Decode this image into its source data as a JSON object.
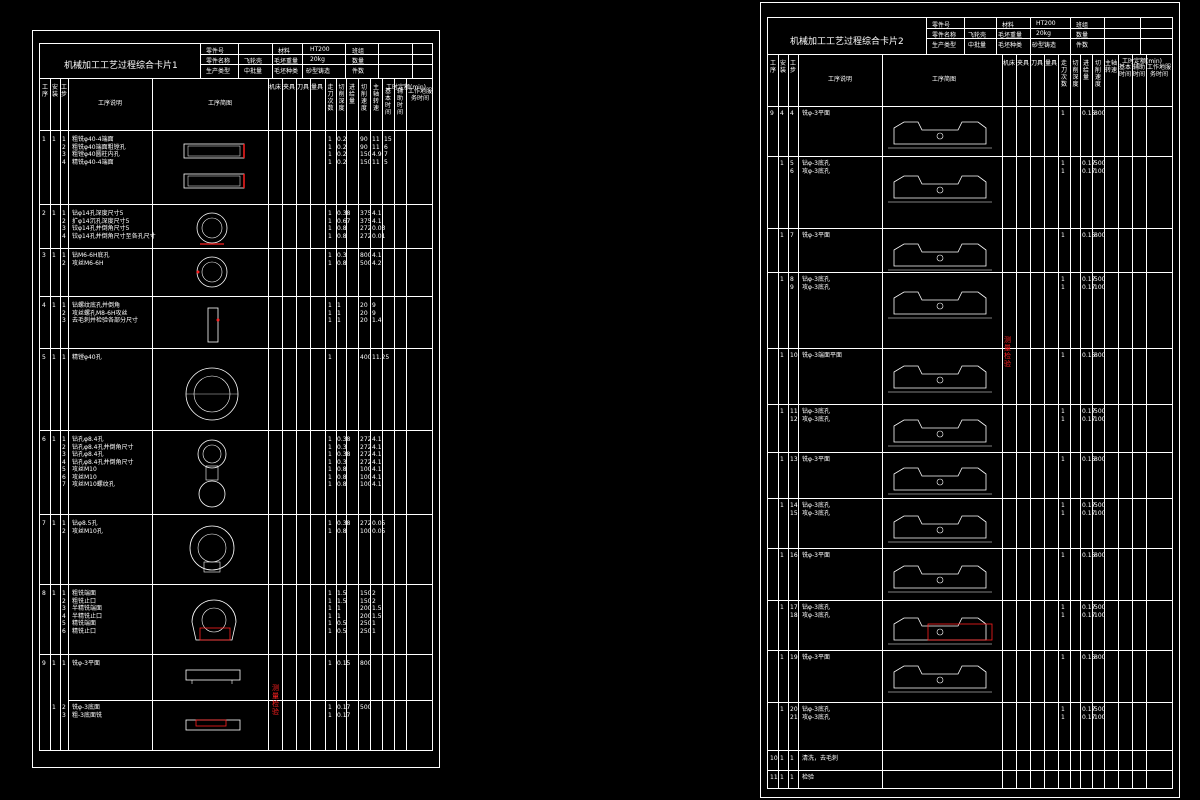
{
  "sheet1": {
    "title": "机械加工工艺过程综合卡片1",
    "header": {
      "label_a": "零件号",
      "label_b": "零件名称",
      "label_c": "生产类型",
      "val_b": "飞轮壳",
      "val_c": "中批量",
      "label_d": "材料",
      "label_e": "毛坯重量",
      "label_f": "毛坯种类",
      "val_d": "HT200",
      "val_e": "20kg",
      "val_f": "砂型铸造",
      "label_g": "班组",
      "label_h": "数量",
      "label_i": "件数",
      "time_label": "工时定额(min)"
    },
    "cols": [
      "工序",
      "安装",
      "工步",
      "工序说明",
      "工序简图",
      "机床",
      "夹具",
      "刀具",
      "量具",
      "走刀次数",
      "切削深度",
      "进给量",
      "切削速度",
      "主轴转速",
      "基本时间",
      "辅助时间",
      "工作地服务时间"
    ],
    "rows": [
      {
        "op": "1",
        "inst": "1",
        "steps": [
          "1",
          "2",
          "3",
          "4"
        ],
        "lines": [
          "粗铣φ40-4端面",
          "粗铣φ40端面粗镗孔",
          "粗镗φ40圆柱内孔",
          "精铣φ40-4端面"
        ],
        "nums": [
          "1",
          "1",
          "1",
          "1"
        ],
        "vals": [
          "0.2",
          "0.2",
          "0.2",
          "0.2"
        ],
        "speed": [
          "90",
          "90",
          "150",
          "150"
        ],
        "time": [
          "11",
          "11",
          "4.9",
          "11"
        ],
        "aux": [
          "15",
          "6",
          "7",
          "5"
        ]
      },
      {
        "op": "2",
        "inst": "1",
        "steps": [
          "1",
          "2",
          "3",
          "4"
        ],
        "lines": [
          "钻φ14孔深度尺寸5",
          "扩φ14沉孔深度尺寸5",
          "铰φ14孔并倒角尺寸5",
          "铰φ14孔并倒角尺寸至各孔尺寸"
        ],
        "nums": [
          "1",
          "1",
          "1",
          "1"
        ],
        "vals": [
          "0.38",
          "0.67",
          "0.8",
          "0.8"
        ],
        "speed": [
          "375",
          "375",
          "272",
          "272"
        ],
        "time": [
          "4.1",
          "4.1",
          "0.03",
          "0.01"
        ],
        "aux": []
      },
      {
        "op": "3",
        "inst": "1",
        "steps": [
          "1",
          "2"
        ],
        "lines": [
          "钻M6-6H底孔",
          "攻丝M6-6H"
        ],
        "nums": [
          "1",
          "1"
        ],
        "vals": [
          "0.3",
          "0.8"
        ],
        "speed": [
          "800",
          "500"
        ],
        "time": [
          "4.1",
          "4.2"
        ],
        "aux": []
      },
      {
        "op": "4",
        "inst": "1",
        "steps": [
          "1",
          "2",
          "3"
        ],
        "lines": [
          "钻螺纹底孔并倒角",
          "攻丝螺孔M8-6H攻丝",
          "去毛刺并检验各部分尺寸"
        ],
        "nums": [
          "1",
          "1",
          "1"
        ],
        "vals": [
          "1",
          "1",
          "1"
        ],
        "speed": [
          "20",
          "20",
          "20"
        ],
        "time": [
          "9",
          "9",
          "1.4"
        ],
        "aux": []
      },
      {
        "op": "5",
        "inst": "1",
        "steps": [
          "1"
        ],
        "lines": [
          "精镗φ40孔"
        ],
        "nums": [
          "1"
        ],
        "vals": [
          ""
        ],
        "speed": [
          "400"
        ],
        "time": [
          "11.25"
        ],
        "aux": []
      },
      {
        "op": "6",
        "inst": "1",
        "steps": [
          "1",
          "2",
          "3",
          "4",
          "5",
          "6",
          "7"
        ],
        "lines": [
          "钻孔φ8.4孔",
          "钻孔φ8.4孔并倒角尺寸",
          "钻孔φ8.4孔",
          "钻孔φ8.4孔并倒角尺寸",
          "攻丝M10",
          "攻丝M10",
          "攻丝M10螺纹孔"
        ],
        "nums": [
          "1",
          "1",
          "1",
          "1",
          "1",
          "1",
          "1"
        ],
        "vals": [
          "0.38",
          "0.3",
          "0.38",
          "0.3",
          "0.8",
          "0.8",
          "0.8"
        ],
        "speed": [
          "272",
          "272",
          "272",
          "272",
          "100",
          "100",
          "100"
        ],
        "time": [
          "4.1",
          "4.1",
          "4.1",
          "4.1",
          "4.1",
          "4.1",
          "4.1"
        ],
        "aux": []
      },
      {
        "op": "7",
        "inst": "1",
        "steps": [
          "1",
          "2"
        ],
        "lines": [
          "钻φ8.5孔",
          "攻丝M10孔"
        ],
        "nums": [
          "1",
          "1"
        ],
        "vals": [
          "0.38",
          "0.8"
        ],
        "speed": [
          "272",
          "100"
        ],
        "time": [
          "0.05",
          "0.05"
        ],
        "aux": []
      },
      {
        "op": "8",
        "inst": "1",
        "steps": [
          "1",
          "2",
          "3",
          "4",
          "5",
          "6"
        ],
        "lines": [
          "粗铣端面",
          "粗铣止口",
          "半精铣端面",
          "半精铣止口",
          "精铣端面",
          "精铣止口"
        ],
        "nums": [
          "1",
          "1",
          "1",
          "1",
          "1",
          "1"
        ],
        "vals": [
          "1.5",
          "1.5",
          "1",
          "1",
          "0.5",
          "0.5"
        ],
        "speed": [
          "150",
          "150",
          "200",
          "200",
          "250",
          "250"
        ],
        "time": [
          "2",
          "2",
          "1.5",
          "1.5",
          "1",
          "1"
        ],
        "aux": []
      },
      {
        "op": "9",
        "inst": "1",
        "steps": [
          "1"
        ],
        "lines": [
          "铣φ-3平面"
        ],
        "nums": [
          "1"
        ],
        "vals": [
          "0.15"
        ],
        "speed": [
          "800"
        ],
        "time": [
          ""
        ],
        "aux": []
      },
      {
        "op": "",
        "inst": "1",
        "steps": [
          "2",
          "3"
        ],
        "lines": [
          "铣φ-3底面",
          "粗-3底面铣"
        ],
        "nums": [
          "1",
          "1"
        ],
        "vals": [
          "0.17",
          "0.17"
        ],
        "speed": [
          "500",
          ""
        ],
        "time": [],
        "aux": []
      }
    ],
    "red_note": "测量检验"
  },
  "sheet2": {
    "title": "机械加工工艺过程综合卡片2",
    "header": {
      "label_a": "零件号",
      "label_b": "零件名称",
      "label_c": "生产类型",
      "val_b": "飞轮壳",
      "val_c": "中批量",
      "label_d": "材料",
      "label_e": "毛坯重量",
      "label_f": "毛坯种类",
      "val_d": "HT200",
      "val_e": "20kg",
      "val_f": "砂型铸造",
      "label_g": "班组",
      "label_h": "数量",
      "label_i": "件数",
      "time_label": "工时定额(min)"
    },
    "rows": [
      {
        "op": "9",
        "inst": "4",
        "steps": [
          "4"
        ],
        "lines": [
          "铣φ-3平面"
        ],
        "nums": [
          "1"
        ],
        "vals": [
          "0.15"
        ],
        "speed": [
          "800"
        ]
      },
      {
        "op": "",
        "inst": "1",
        "steps": [
          "5",
          "6"
        ],
        "lines": [
          "钻φ-3底孔",
          "攻φ-3底孔"
        ],
        "nums": [
          "1",
          "1"
        ],
        "vals": [
          "0.17",
          "0.17"
        ],
        "speed": [
          "500",
          "100"
        ]
      },
      {
        "op": "",
        "inst": "1",
        "steps": [
          "7"
        ],
        "lines": [
          "铣φ-3平面"
        ],
        "nums": [
          "1"
        ],
        "vals": [
          "0.15"
        ],
        "speed": [
          "800"
        ]
      },
      {
        "op": "",
        "inst": "1",
        "steps": [
          "8",
          "9"
        ],
        "lines": [
          "钻φ-3底孔",
          "攻φ-3底孔"
        ],
        "nums": [
          "1",
          "1"
        ],
        "vals": [
          "0.17",
          "0.17"
        ],
        "speed": [
          "500",
          "100"
        ]
      },
      {
        "op": "",
        "inst": "1",
        "steps": [
          "10"
        ],
        "lines": [
          "铣φ-3端面平面"
        ],
        "nums": [
          "1"
        ],
        "vals": [
          "0.15"
        ],
        "speed": [
          "800"
        ]
      },
      {
        "op": "",
        "inst": "1",
        "steps": [
          "11",
          "12"
        ],
        "lines": [
          "钻φ-3底孔",
          "攻φ-3底孔"
        ],
        "nums": [
          "1",
          "1"
        ],
        "vals": [
          "0.17",
          "0.17"
        ],
        "speed": [
          "500",
          "100"
        ]
      },
      {
        "op": "",
        "inst": "1",
        "steps": [
          "13"
        ],
        "lines": [
          "铣φ-3平面"
        ],
        "nums": [
          "1"
        ],
        "vals": [
          "0.15"
        ],
        "speed": [
          "800"
        ]
      },
      {
        "op": "",
        "inst": "1",
        "steps": [
          "14",
          "15"
        ],
        "lines": [
          "钻φ-3底孔",
          "攻φ-3底孔"
        ],
        "nums": [
          "1",
          "1"
        ],
        "vals": [
          "0.17",
          "0.17"
        ],
        "speed": [
          "500",
          "100"
        ]
      },
      {
        "op": "",
        "inst": "1",
        "steps": [
          "16"
        ],
        "lines": [
          "铣φ-3平面"
        ],
        "nums": [
          "1"
        ],
        "vals": [
          "0.15"
        ],
        "speed": [
          "800"
        ]
      },
      {
        "op": "",
        "inst": "1",
        "steps": [
          "17",
          "18"
        ],
        "lines": [
          "钻φ-3底孔",
          "攻φ-3底孔"
        ],
        "nums": [
          "1",
          "1"
        ],
        "vals": [
          "0.17",
          "0.17"
        ],
        "speed": [
          "500",
          "100"
        ]
      },
      {
        "op": "",
        "inst": "1",
        "steps": [
          "19"
        ],
        "lines": [
          "铣φ-3平面"
        ],
        "nums": [
          "1"
        ],
        "vals": [
          "0.15"
        ],
        "speed": [
          "800"
        ]
      },
      {
        "op": "",
        "inst": "1",
        "steps": [
          "20",
          "21"
        ],
        "lines": [
          "钻φ-3底孔",
          "攻φ-3底孔"
        ],
        "nums": [
          "1",
          "1"
        ],
        "vals": [
          "0.17",
          "0.17"
        ],
        "speed": [
          "500",
          "100"
        ]
      },
      {
        "op": "10",
        "inst": "1",
        "steps": [
          "1"
        ],
        "lines": [
          "清洗，去毛刺"
        ],
        "nums": [],
        "vals": [],
        "speed": []
      },
      {
        "op": "11",
        "inst": "1",
        "steps": [
          "1"
        ],
        "lines": [
          "检验"
        ],
        "nums": [],
        "vals": [],
        "speed": []
      }
    ],
    "red_note": "测量检验"
  }
}
